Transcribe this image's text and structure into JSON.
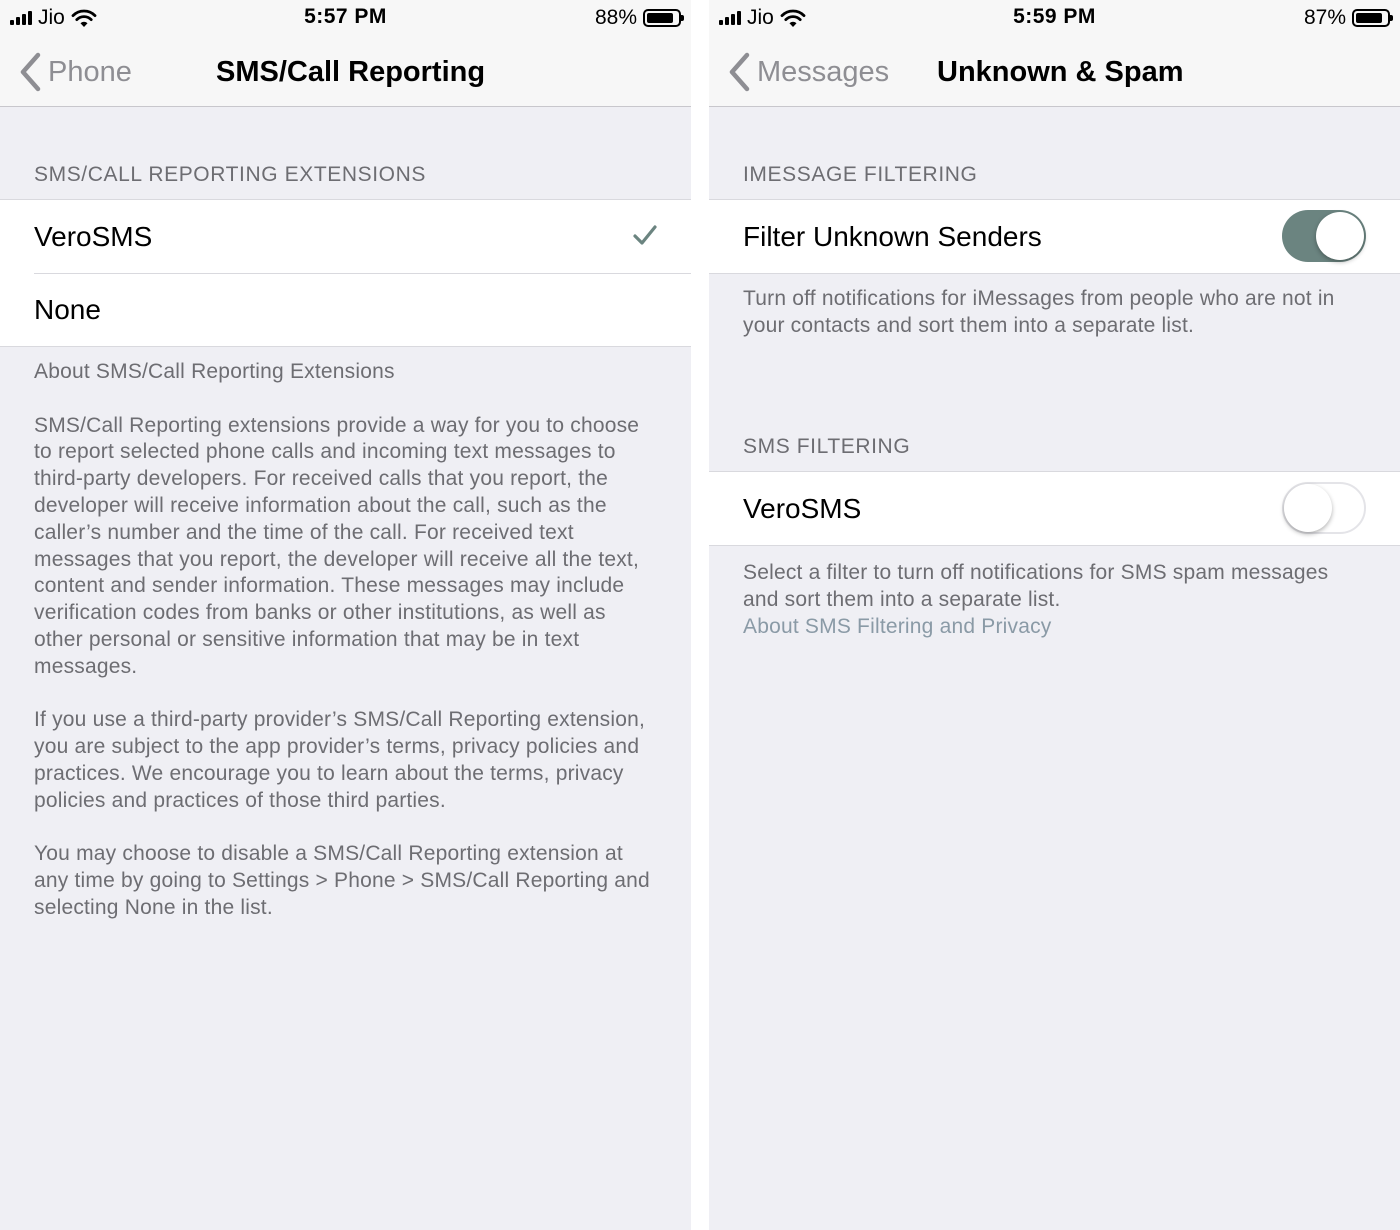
{
  "left": {
    "status": {
      "carrier": "Jio",
      "time": "5:57 PM",
      "battery": "88%",
      "battery_level": 0.88
    },
    "nav": {
      "back_label": "Phone",
      "title": "SMS/Call Reporting"
    },
    "section_header": "SMS/CALL REPORTING EXTENSIONS",
    "options": [
      {
        "label": "VeroSMS",
        "selected": true
      },
      {
        "label": "None",
        "selected": false
      }
    ],
    "about_title": "About SMS/Call Reporting Extensions",
    "paragraphs": [
      "SMS/Call Reporting extensions provide a way for you to choose to report selected phone calls and incoming text messages to third-party developers. For received calls that you report, the developer will receive information about the call, such as the caller’s number and the time of the call. For received text messages that you report, the developer will receive all the text, content and sender information. These messages may include verification codes from banks or other institutions, as well as other personal or sensitive information that may be in text messages.",
      "If you use a third-party provider’s SMS/Call Reporting extension, you are subject to the app provider’s terms, privacy policies and practices. We encourage you to learn about the terms, privacy policies and practices of those third parties.",
      "You may choose to disable a SMS/Call Reporting extension at any time by going to Settings > Phone > SMS/Call Reporting and selecting None in the list."
    ]
  },
  "right": {
    "status": {
      "carrier": "Jio",
      "time": "5:59 PM",
      "battery": "87%",
      "battery_level": 0.87
    },
    "nav": {
      "back_label": "Messages",
      "title": "Unknown & Spam"
    },
    "imessage_section": {
      "header": "IMESSAGE FILTERING",
      "label": "Filter Unknown Senders",
      "enabled": true,
      "footer": "Turn off notifications for iMessages from people who are not in your contacts and sort them into a separate list."
    },
    "sms_section": {
      "header": "SMS FILTERING",
      "label": "VeroSMS",
      "enabled": false,
      "footer": "Select a filter to turn off notifications for SMS spam messages and sort them into a separate list.",
      "link": "About SMS Filtering and Privacy"
    }
  },
  "colors": {
    "background": "#efeff4",
    "toggle_on": "#6b8480",
    "secondary_text": "#6d6d72",
    "link": "#8a9aa6"
  }
}
